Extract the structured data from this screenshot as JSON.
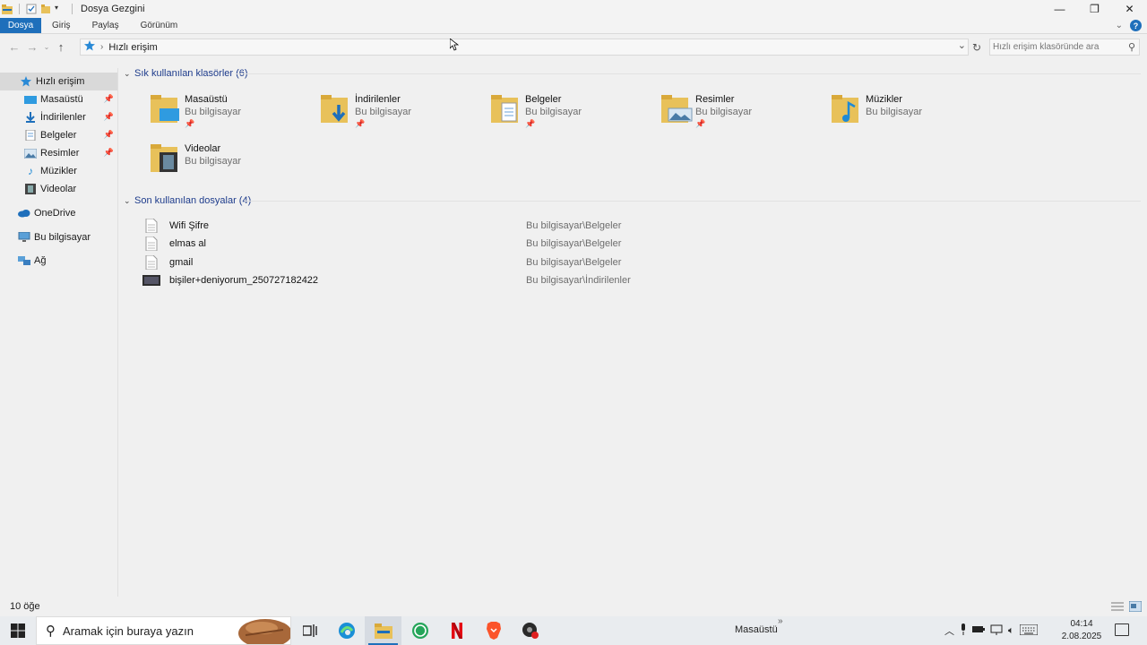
{
  "window": {
    "title": "Dosya Gezgini",
    "minimize": "—",
    "restore": "❐",
    "close": "✕"
  },
  "ribbon": {
    "tabs": [
      "Dosya",
      "Giriş",
      "Paylaş",
      "Görünüm"
    ],
    "help": "?"
  },
  "address": {
    "crumb": "Hızlı erişim",
    "search_placeholder": "Hızlı erişim klasöründe ara"
  },
  "sidebar": {
    "items": [
      {
        "label": "Hızlı erişim",
        "icon": "star-icon"
      },
      {
        "label": "Masaüstü",
        "icon": "desktop-icon",
        "pinned": true
      },
      {
        "label": "İndirilenler",
        "icon": "download-icon",
        "pinned": true
      },
      {
        "label": "Belgeler",
        "icon": "documents-icon",
        "pinned": true
      },
      {
        "label": "Resimler",
        "icon": "pictures-icon",
        "pinned": true
      },
      {
        "label": "Müzikler",
        "icon": "music-icon"
      },
      {
        "label": "Videolar",
        "icon": "video-icon"
      },
      {
        "label": "OneDrive",
        "icon": "cloud-icon"
      },
      {
        "label": "Bu bilgisayar",
        "icon": "computer-icon"
      },
      {
        "label": "Ağ",
        "icon": "network-icon"
      }
    ]
  },
  "frequent": {
    "header": "Sık kullanılan klasörler (6)",
    "folders": [
      {
        "name": "Masaüstü",
        "location": "Bu bilgisayar",
        "pinned": true,
        "overlay": "desktop"
      },
      {
        "name": "İndirilenler",
        "location": "Bu bilgisayar",
        "pinned": true,
        "overlay": "download"
      },
      {
        "name": "Belgeler",
        "location": "Bu bilgisayar",
        "pinned": true,
        "overlay": "documents"
      },
      {
        "name": "Resimler",
        "location": "Bu bilgisayar",
        "pinned": true,
        "overlay": "pictures"
      },
      {
        "name": "Müzikler",
        "location": "Bu bilgisayar",
        "pinned": false,
        "overlay": "music"
      },
      {
        "name": "Videolar",
        "location": "Bu bilgisayar",
        "pinned": false,
        "overlay": "video"
      }
    ]
  },
  "recent": {
    "header": "Son kullanılan dosyalar (4)",
    "files": [
      {
        "name": "Wifi Şifre",
        "location": "Bu bilgisayar\\Belgeler",
        "icon": "text-file-icon"
      },
      {
        "name": "elmas al",
        "location": "Bu bilgisayar\\Belgeler",
        "icon": "text-file-icon"
      },
      {
        "name": "gmail",
        "location": "Bu bilgisayar\\Belgeler",
        "icon": "text-file-icon"
      },
      {
        "name": "bişiler+deniyorum_250727182422",
        "location": "Bu bilgisayar\\İndirilenler",
        "icon": "video-file-icon"
      }
    ]
  },
  "status": {
    "count": "10 öğe"
  },
  "taskbar": {
    "search_text": "Aramak için buraya yazın",
    "desktop_label": "Masaüstü",
    "desktop_chevron": "»",
    "time": "04:14",
    "date": "2.08.2025"
  },
  "colors": {
    "accent": "#1e6fbb",
    "group_header": "#1e3c8c",
    "folder": "#e8c15a"
  }
}
